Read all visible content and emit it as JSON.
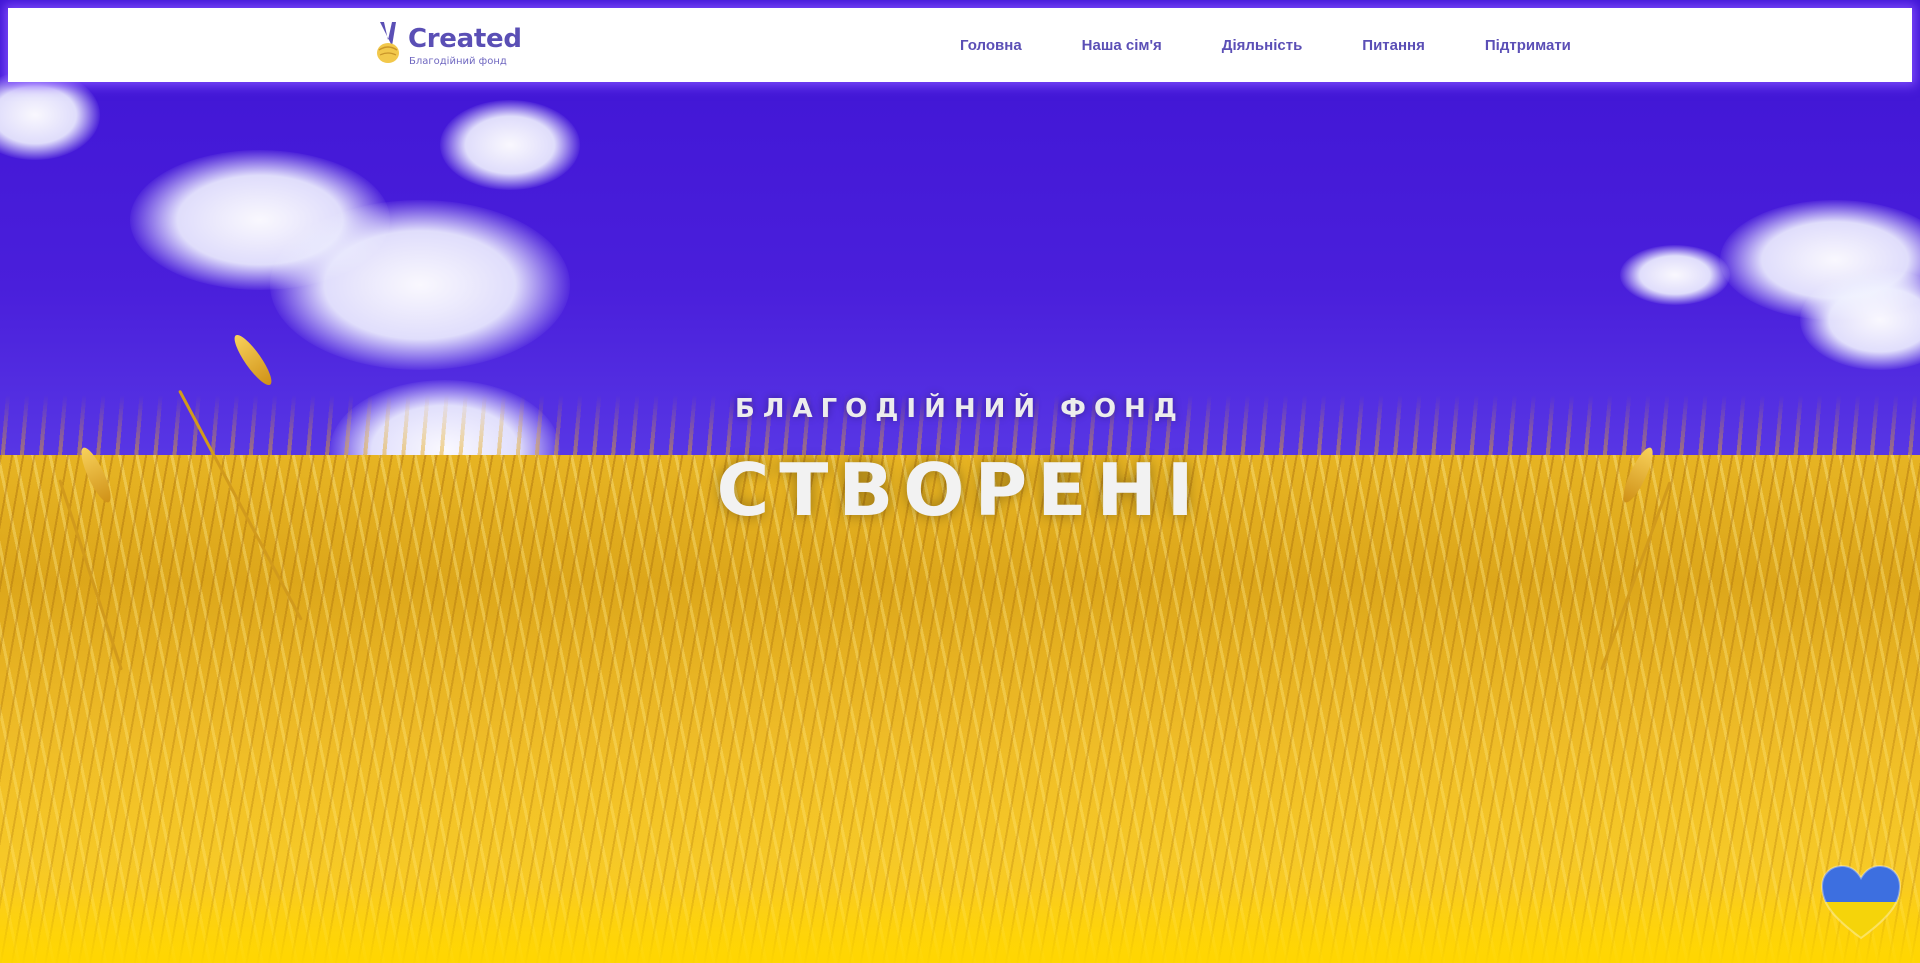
{
  "header": {
    "logo_title": "Created",
    "logo_subtitle": "Благодійний фонд",
    "nav": [
      {
        "label": "Головна"
      },
      {
        "label": "Наша сім'я"
      },
      {
        "label": "Діяльність"
      },
      {
        "label": "Питання"
      },
      {
        "label": "Підтримати"
      }
    ]
  },
  "hero": {
    "subtitle": "БЛАГОДІЙНИЙ ФОНД",
    "title": "СТВОРЕНІ"
  },
  "icons": {
    "logo": "victory-hand-icon",
    "floating": "ukraine-heart-icon"
  },
  "colors": {
    "brand": "#5a4fb5",
    "sky": "#4a1fdb",
    "wheat": "#e9b52a",
    "flag_blue": "#3d6fe0",
    "flag_yellow": "#f5d40a"
  }
}
